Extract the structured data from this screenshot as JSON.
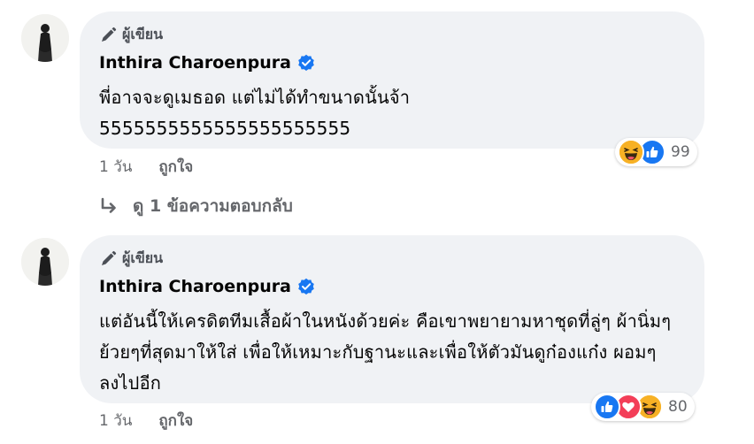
{
  "comments": [
    {
      "author_badge": "ผู้เขียน",
      "author_name": "Inthira Charoenpura",
      "text": "พี่อาจจะดูเมธอด แต่ไม่ได้ทำขนาดนั้นจ้า\n5555555555555555555555",
      "time": "1 วัน",
      "like_label": "ถูกใจ",
      "reaction_count": "99",
      "reactions": [
        "haha-icon",
        "like-icon"
      ],
      "reply_label": "ดู 1 ข้อความตอบกลับ"
    },
    {
      "author_badge": "ผู้เขียน",
      "author_name": "Inthira Charoenpura",
      "text": "แต่อันนี้ให้เครดิตทีมเสื้อผ้าในหนังด้วยค่ะ คือเขาพยายามหาชุดที่ลู่ๆ ผ้านิ่มๆ ย้วยๆที่สุดมาให้ใส่ เพื่อให้เหมาะกับฐานะและเพื่อให้ตัวมันดูก๋องแก๋ง ผอมๆลงไปอีก",
      "time": "1 วัน",
      "like_label": "ถูกใจ",
      "reaction_count": "80",
      "reactions": [
        "like-icon",
        "love-icon",
        "haha-icon"
      ]
    }
  ],
  "colors": {
    "bubble": "#f0f2f5",
    "meta_text": "#65676b",
    "like_blue": "#1877f2",
    "love_red": "#f33e58",
    "haha_yellow": "#f7b125"
  }
}
